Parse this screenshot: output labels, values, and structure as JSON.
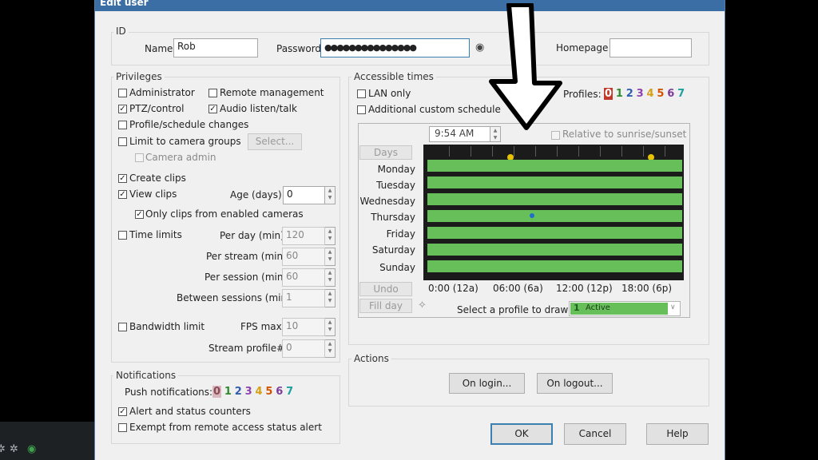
{
  "dialog": {
    "title": "Edit user"
  },
  "id_group": {
    "label": "ID",
    "name_label": "Name",
    "name_value": "Rob",
    "password_label": "Password",
    "password_value": "●●●●●●●●●●●●●●●",
    "homepage_label": "Homepage",
    "homepage_value": ""
  },
  "privileges": {
    "label": "Privileges",
    "administrator": "Administrator",
    "remote_management": "Remote management",
    "ptz_control": "PTZ/control",
    "audio_listen_talk": "Audio listen/talk",
    "profile_schedule_changes": "Profile/schedule changes",
    "limit_camera_groups": "Limit to camera groups",
    "select_button": "Select...",
    "camera_admin": "Camera admin",
    "create_clips": "Create clips",
    "view_clips": "View clips",
    "age_label": "Age (days):",
    "age_value": "0",
    "only_clips_enabled": "Only clips from enabled cameras",
    "time_limits": "Time limits",
    "per_day_label": "Per day (min):",
    "per_day_value": "120",
    "per_stream_label": "Per stream (min):",
    "per_stream_value": "60",
    "per_session_label": "Per session (min):",
    "per_session_value": "60",
    "between_sessions_label": "Between sessions (min):",
    "between_sessions_value": "1",
    "bandwidth_limit": "Bandwidth limit",
    "fps_max_label": "FPS max:",
    "fps_max_value": "10",
    "stream_profile_label": "Stream profile#:",
    "stream_profile_value": "0"
  },
  "notifications": {
    "label": "Notifications",
    "push_label": "Push notifications:",
    "digits": [
      "0",
      "1",
      "2",
      "3",
      "4",
      "5",
      "6",
      "7"
    ],
    "alert_counters": "Alert and status counters",
    "exempt_remote": "Exempt from remote access status alert"
  },
  "accessible_times": {
    "label": "Accessible times",
    "lan_only": "LAN only",
    "additional_schedule": "Additional custom schedule",
    "profiles_label": "Profiles:",
    "profile_digits": [
      "0",
      "1",
      "2",
      "3",
      "4",
      "5",
      "6",
      "7"
    ],
    "time_value": "9:54 AM",
    "relative_sunrise": "Relative to sunrise/sunset",
    "days_button": "Days",
    "days": [
      "Monday",
      "Tuesday",
      "Wednesday",
      "Thursday",
      "Friday",
      "Saturday",
      "Sunday"
    ],
    "time_axis": [
      "0:00 (12a)",
      "06:00 (6a)",
      "12:00 (12p)",
      "18:00 (6p)"
    ],
    "undo_button": "Undo",
    "fill_day_button": "Fill day",
    "select_profile_label": "Select a profile to draw:",
    "selected_profile_number": "1",
    "selected_profile_name": "Active"
  },
  "actions": {
    "label": "Actions",
    "on_login": "On login...",
    "on_logout": "On logout..."
  },
  "footer": {
    "ok": "OK",
    "cancel": "Cancel",
    "help": "Help"
  },
  "colors": {
    "digit_colors": [
      "#c0392b",
      "#2e8b2e",
      "#2f5fae",
      "#8e44ad",
      "#d4a017",
      "#d35400",
      "#7d3c98",
      "#1f9e9e"
    ],
    "schedule_active": "#67bf5a",
    "title_bar": "#3b6ea5"
  }
}
